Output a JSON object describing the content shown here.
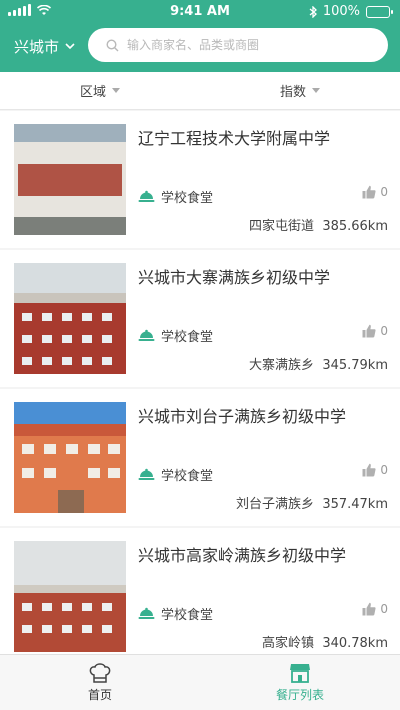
{
  "status": {
    "time": "9:41 AM",
    "battery": "100%"
  },
  "header": {
    "city": "兴城市",
    "search_placeholder": "输入商家名、品类或商圈"
  },
  "filters": [
    {
      "label": "区域"
    },
    {
      "label": "指数"
    }
  ],
  "items": [
    {
      "title": "辽宁工程技术大学附属中学",
      "category": "学校食堂",
      "likes": "0",
      "location": "四家屯街道",
      "distance": "385.66km"
    },
    {
      "title": "兴城市大寨满族乡初级中学",
      "category": "学校食堂",
      "likes": "0",
      "location": "大寨满族乡",
      "distance": "345.79km"
    },
    {
      "title": "兴城市刘台子满族乡初级中学",
      "category": "学校食堂",
      "likes": "0",
      "location": "刘台子满族乡",
      "distance": "357.47km"
    },
    {
      "title": "兴城市高家岭满族乡初级中学",
      "category": "学校食堂",
      "likes": "0",
      "location": "高家岭镇",
      "distance": "340.78km"
    }
  ],
  "tabs": [
    {
      "label": "首页"
    },
    {
      "label": "餐厅列表"
    }
  ],
  "colors": {
    "accent": "#37b08f",
    "header": "#37b08f"
  }
}
